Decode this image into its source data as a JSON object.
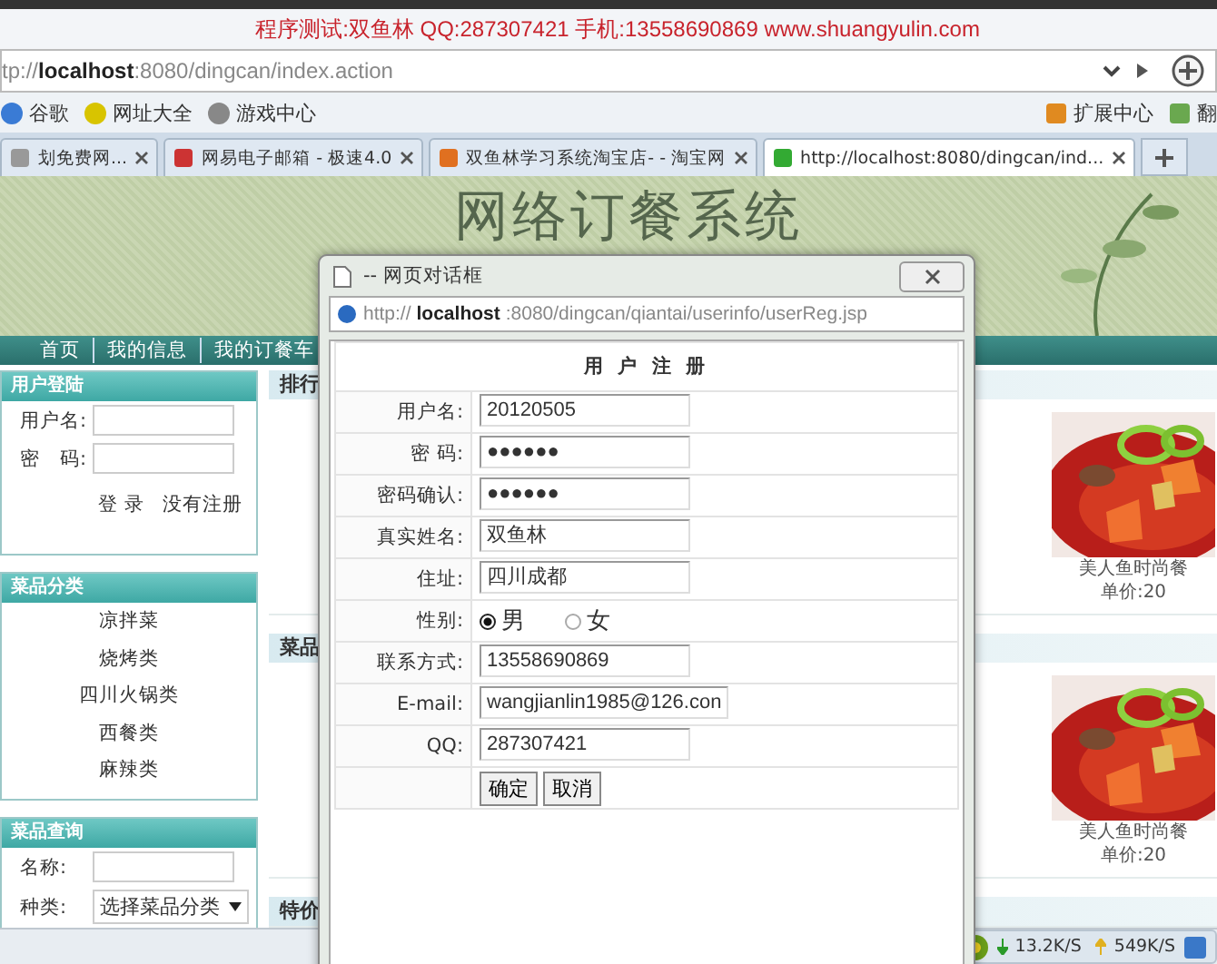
{
  "caption": "程序测试:双鱼林 QQ:287307421 手机:13558690869 www.shuangyulin.com",
  "address_bar": {
    "url_dim_start": "tp://",
    "url_host": "localhost",
    "url_dim_end": ":8080/dingcan/index.action"
  },
  "bookmarks": [
    {
      "label": "谷歌"
    },
    {
      "label": "网址大全"
    },
    {
      "label": "游戏中心"
    }
  ],
  "bookmarks_right": [
    {
      "label": "扩展中心"
    },
    {
      "label": "翻"
    }
  ],
  "tabs": [
    {
      "label": "划免费网...",
      "selected": false
    },
    {
      "label": "网易电子邮箱 - 极速4.0",
      "selected": false
    },
    {
      "label": "双鱼林学习系统淘宝店- - 淘宝网",
      "selected": false
    },
    {
      "label": "http://localhost:8080/dingcan/ind...",
      "selected": true
    }
  ],
  "site": {
    "title": "网络订餐系统",
    "nav": [
      "首页",
      "我的信息",
      "我的订餐车"
    ],
    "login": {
      "title": "用户登陆",
      "fields": [
        "用户名:",
        "密　码:"
      ],
      "buttons": [
        "登 录",
        "没有注册"
      ]
    },
    "categories": {
      "title": "菜品分类",
      "items": [
        "凉拌菜",
        "烧烤类",
        "四川火锅类",
        "西餐类",
        "麻辣类"
      ]
    },
    "search": {
      "title": "菜品查询",
      "name_label": "名称:",
      "kind_label": "种类:",
      "kind_value": "选择菜品分类"
    },
    "sections": [
      {
        "title": "排行",
        "dish": {
          "name": "美人鱼时尚餐",
          "price": "单价:20"
        }
      },
      {
        "title": "菜品",
        "dish": {
          "name": "美人鱼时尚餐",
          "price": "单价:20"
        }
      },
      {
        "title": "特价"
      }
    ]
  },
  "status_bar": {
    "down": "13.2K/S",
    "up": "549K/S"
  },
  "dialog": {
    "title": "-- 网页对话框",
    "url_start": "http://",
    "url_host": "localhost",
    "url_end": ":8080/dingcan/qiantai/userinfo/userReg.jsp",
    "heading": "用 户 注 册",
    "rows": [
      {
        "kind": "text",
        "label": "用户名:",
        "value": "20120505"
      },
      {
        "kind": "text",
        "label": "密 码:",
        "value": "●●●●●●"
      },
      {
        "kind": "text",
        "label": "密码确认:",
        "value": "●●●●●●"
      },
      {
        "kind": "text",
        "label": "真实姓名:",
        "value": "双鱼林"
      },
      {
        "kind": "text",
        "label": "住址:",
        "value": "四川成都"
      },
      {
        "kind": "radio",
        "label": "性别:",
        "options": [
          {
            "label": "男",
            "selected": true
          },
          {
            "label": "女",
            "selected": false
          }
        ]
      },
      {
        "kind": "text",
        "label": "联系方式:",
        "value": "13558690869"
      },
      {
        "kind": "text",
        "label": "E-mail:",
        "value": "wangjianlin1985@126.con"
      },
      {
        "kind": "text",
        "label": "QQ:",
        "value": "287307421"
      },
      {
        "kind": "buttons",
        "buttons": [
          "确定",
          "取消"
        ]
      }
    ]
  }
}
